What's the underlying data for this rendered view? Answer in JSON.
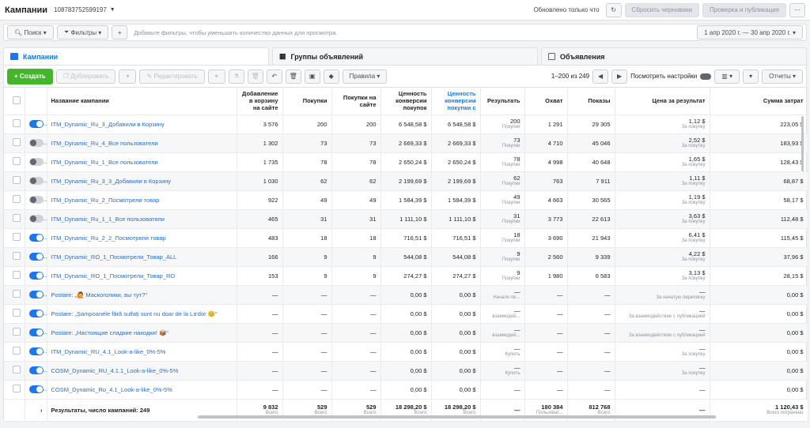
{
  "header": {
    "title": "Кампании",
    "account_id": "108783752599197",
    "updated_label": "Обновлено только что",
    "reset_drafts": "Сбросить черновики",
    "review_publish": "Проверка и публикация"
  },
  "filters": {
    "search": "Поиск",
    "filters": "Фильтры",
    "hint": "Добавьте фильтры, чтобы уменьшить количество данных для просмотра.",
    "date_range": "1 апр 2020 г. — 30 апр 2020 г."
  },
  "tabs": [
    "Кампании",
    "Группы объявлений",
    "Объявления"
  ],
  "toolbar": {
    "create": "Создать",
    "duplicate": "Дублировать",
    "edit": "Редактировать",
    "rules": "Правила",
    "range": "1–200 из 249",
    "view_settings": "Посмотреть настройки",
    "reports": "Отчеты"
  },
  "columns": [
    "Название кампании",
    "Добавление в корзину на сайте",
    "Покупки",
    "Покупки на сайте",
    "Ценность конверсии покупок",
    "Ценность конверсии покупки с",
    "Результать",
    "Охват",
    "Показы",
    "Цена за результат",
    "Сумма затрат"
  ],
  "rows": [
    {
      "on": true,
      "name": "ITM_Dynamic_Ru_3_Добавили в Корзину",
      "cart": "3 576",
      "purch": "200",
      "purch_site": "200",
      "conv": "6 548,58 $",
      "conv2": "6 548,58 $",
      "res": "200",
      "res_sub": "Покупки",
      "reach": "1 291",
      "impr": "29 305",
      "cpr": "1,12 $",
      "cpr_sub": "За покупку",
      "spend": "223,05 $"
    },
    {
      "on": false,
      "name": "ITM_Dynamic_Ru_4_Все пользователи",
      "cart": "1 302",
      "purch": "73",
      "purch_site": "73",
      "conv": "2 669,33 $",
      "conv2": "2 669,33 $",
      "res": "73",
      "res_sub": "Покупки",
      "reach": "4 710",
      "impr": "45 046",
      "cpr": "2,52 $",
      "cpr_sub": "За покупку",
      "spend": "183,93 $"
    },
    {
      "on": false,
      "name": "ITM_Dynamic_Ru_1_Все пользователи",
      "cart": "1 735",
      "purch": "78",
      "purch_site": "78",
      "conv": "2 650,24 $",
      "conv2": "2 650,24 $",
      "res": "78",
      "res_sub": "Покупки",
      "reach": "4 998",
      "impr": "40 648",
      "cpr": "1,65 $",
      "cpr_sub": "За покупку",
      "spend": "128,43 $"
    },
    {
      "on": false,
      "name": "ITM_Dynamic_Ru_3_3_Добавили в Корзину",
      "cart": "1 030",
      "purch": "62",
      "purch_site": "62",
      "conv": "2 199,69 $",
      "conv2": "2 199,69 $",
      "res": "62",
      "res_sub": "Покупки",
      "reach": "763",
      "impr": "7 911",
      "cpr": "1,11 $",
      "cpr_sub": "За покупку",
      "spend": "68,87 $"
    },
    {
      "on": false,
      "name": "ITM_Dynamic_Ru_2_Посмотрели товар",
      "cart": "922",
      "purch": "49",
      "purch_site": "49",
      "conv": "1 584,39 $",
      "conv2": "1 584,39 $",
      "res": "49",
      "res_sub": "Покупки",
      "reach": "4 663",
      "impr": "30 565",
      "cpr": "1,19 $",
      "cpr_sub": "За покупку",
      "spend": "58,17 $"
    },
    {
      "on": false,
      "name": "ITM_Dynamic_Ru_1_1_Все пользователи",
      "cart": "465",
      "purch": "31",
      "purch_site": "31",
      "conv": "1 111,10 $",
      "conv2": "1 111,10 $",
      "res": "31",
      "res_sub": "Покупки",
      "reach": "3 773",
      "impr": "22 613",
      "cpr": "3,63 $",
      "cpr_sub": "За покупку",
      "spend": "112,48 $"
    },
    {
      "on": true,
      "name": "ITM_Dynamic_Ru_2_2_Посмотрели товар",
      "cart": "483",
      "purch": "18",
      "purch_site": "18",
      "conv": "716,51 $",
      "conv2": "716,51 $",
      "res": "18",
      "res_sub": "Покупки",
      "reach": "3 690",
      "impr": "21 943",
      "cpr": "6,41 $",
      "cpr_sub": "За покупку",
      "spend": "115,45 $"
    },
    {
      "on": true,
      "name": "ITM_Dynamic_RO_1_Посмотрели_Товар_ALL",
      "cart": "166",
      "purch": "9",
      "purch_site": "9",
      "conv": "544,08 $",
      "conv2": "544,08 $",
      "res": "9",
      "res_sub": "Покупки",
      "reach": "2 560",
      "impr": "9 339",
      "cpr": "4,22 $",
      "cpr_sub": "За покупку",
      "spend": "37,96 $"
    },
    {
      "on": true,
      "name": "ITM_Dynamic_RO_1_Посмотрели_Товар_RO",
      "cart": "153",
      "purch": "9",
      "purch_site": "9",
      "conv": "274,27 $",
      "conv2": "274,27 $",
      "res": "9",
      "res_sub": "Покупки",
      "reach": "1 980",
      "impr": "6 583",
      "cpr": "3,13 $",
      "cpr_sub": "За покупку",
      "spend": "28,15 $"
    },
    {
      "on": true,
      "name": "Postare: „🙋 Маскоголики, вы тут?\"",
      "cart": "—",
      "purch": "—",
      "purch_site": "—",
      "conv": "0,00 $",
      "conv2": "0,00 $",
      "res": "—",
      "res_sub": "Начало пе...",
      "reach": "—",
      "impr": "—",
      "cpr": "—",
      "cpr_sub": "За начатую переписку",
      "spend": "0,00 $"
    },
    {
      "on": true,
      "name": "Postare: „Șampoanele fără sulfați sunt nu doar de la La'dor 😊\"",
      "cart": "—",
      "purch": "—",
      "purch_site": "—",
      "conv": "0,00 $",
      "conv2": "0,00 $",
      "res": "—",
      "res_sub": "взаимодей...",
      "reach": "—",
      "impr": "—",
      "cpr": "—",
      "cpr_sub": "За взаимодействие с публикацией",
      "spend": "0,00 $"
    },
    {
      "on": true,
      "name": "Postare: „Настоящие сладкие находки! 📦\"",
      "cart": "—",
      "purch": "—",
      "purch_site": "—",
      "conv": "0,00 $",
      "conv2": "0,00 $",
      "res": "—",
      "res_sub": "взаимодей...",
      "reach": "—",
      "impr": "—",
      "cpr": "—",
      "cpr_sub": "За взаимодействие с публикацией",
      "spend": "0,00 $"
    },
    {
      "on": true,
      "name": "ITM_Dynamic_RU_4.1_Look-a-like_0%-5%",
      "cart": "—",
      "purch": "—",
      "purch_site": "—",
      "conv": "0,00 $",
      "conv2": "0,00 $",
      "res": "—",
      "res_sub": "Купить",
      "reach": "—",
      "impr": "—",
      "cpr": "—",
      "cpr_sub": "За покупку",
      "spend": "0,00 $"
    },
    {
      "on": true,
      "name": "COSM_Dynamic_RU_4.1.1_Look-a-like_0%-5%",
      "cart": "—",
      "purch": "—",
      "purch_site": "—",
      "conv": "0,00 $",
      "conv2": "0,00 $",
      "res": "—",
      "res_sub": "Купить",
      "reach": "—",
      "impr": "—",
      "cpr": "—",
      "cpr_sub": "За покупку",
      "spend": "0,00 $"
    },
    {
      "on": true,
      "name": "COSM_Dynamic_Ro_4.1_Look-a-like_0%-5%",
      "cart": "—",
      "purch": "—",
      "purch_site": "—",
      "conv": "0,00 $",
      "conv2": "0,00 $",
      "res": "—",
      "res_sub": "",
      "reach": "—",
      "impr": "—",
      "cpr": "—",
      "cpr_sub": "",
      "spend": "0,00 $"
    }
  ],
  "totals": {
    "label": "Результаты, число кампаний: 249",
    "cart": "9 832",
    "cart_sub": "Всего",
    "purch": "529",
    "purch_sub": "Всего",
    "purch_site": "529",
    "purch_site_sub": "Всего",
    "conv": "18 298,20 $",
    "conv_sub": "Всего",
    "conv2": "18 298,20 $",
    "conv2_sub": "Всего",
    "res": "—",
    "reach": "180 384",
    "reach_sub": "Пользоват...",
    "impr": "812 768",
    "impr_sub": "Всего",
    "cpr": "—",
    "spend": "1 120,43 $",
    "spend_sub": "Всего потрачено"
  }
}
